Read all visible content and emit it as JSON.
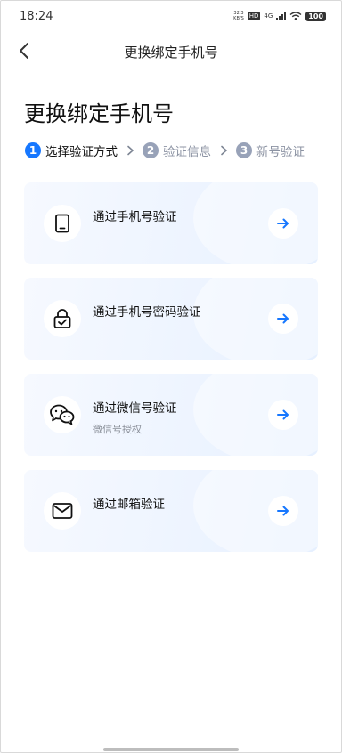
{
  "status_bar": {
    "time": "18:24",
    "net_speed_value": "32.3",
    "net_speed_unit": "KB/S",
    "hd": "HD",
    "signal": "4G",
    "battery": "100"
  },
  "nav": {
    "back_icon": "chevron-left-icon",
    "title": "更换绑定手机号"
  },
  "page_heading": "更换绑定手机号",
  "steps": [
    {
      "number": "1",
      "label": "选择验证方式",
      "state": "active"
    },
    {
      "number": "2",
      "label": "验证信息",
      "state": "inactive"
    },
    {
      "number": "3",
      "label": "新号验证",
      "state": "inactive"
    }
  ],
  "options": [
    {
      "title": "通过手机号验证",
      "subtitle": "",
      "icon": "phone-icon"
    },
    {
      "title": "通过手机号密码验证",
      "subtitle": "",
      "icon": "lock-icon"
    },
    {
      "title": "通过微信号验证",
      "subtitle": "微信号授权",
      "icon": "wechat-icon"
    },
    {
      "title": "通过邮箱验证",
      "subtitle": "",
      "icon": "mail-icon"
    }
  ],
  "colors": {
    "accent": "#1677ff",
    "step_inactive": "#98a2b8",
    "card_background": "#edf4ff"
  }
}
